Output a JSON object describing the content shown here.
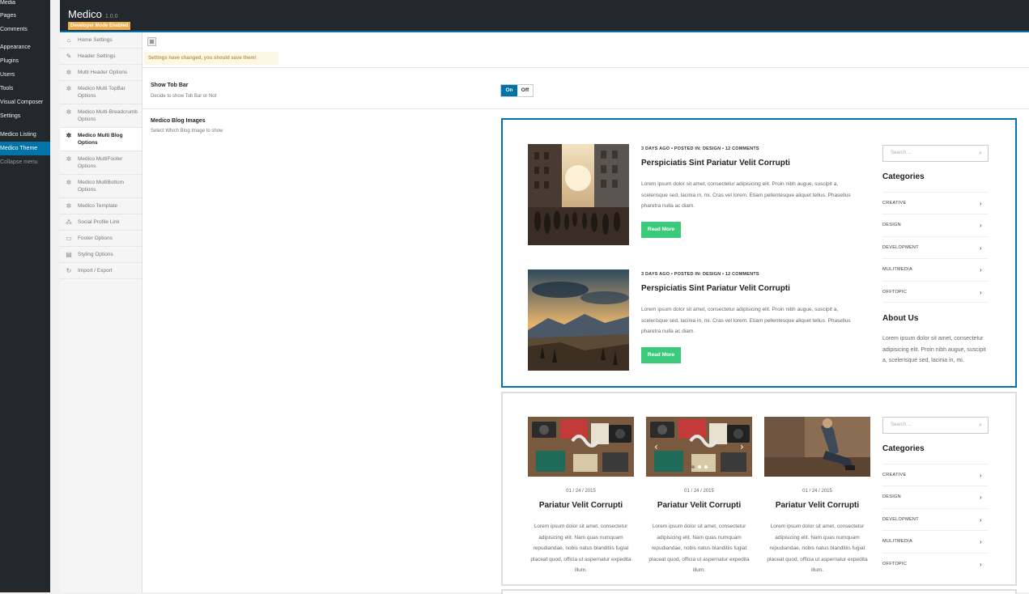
{
  "wp_menu": {
    "items": [
      "Media",
      "Pages",
      "Comments",
      "Appearance",
      "Plugins",
      "Users",
      "Tools",
      "Visual Composer",
      "Settings",
      "Medico Listing",
      "Medico Theme",
      "Collapse menu"
    ],
    "active": "Medico Theme"
  },
  "header": {
    "title": "Medico",
    "version": "1.0.0",
    "badge": "Developer Mode Enabled"
  },
  "sidenav": {
    "items": [
      {
        "label": "Home Settings",
        "icon": "home-icon"
      },
      {
        "label": "Header Settings",
        "icon": "pencil-icon"
      },
      {
        "label": "Multi Header Options",
        "icon": "cog-icon"
      },
      {
        "label": "Medico Multi TopBar Options",
        "icon": "cog-icon"
      },
      {
        "label": "Medico Multi-Breadcrumb Options",
        "icon": "cog-icon"
      },
      {
        "label": "Medico Multi Blog Options",
        "icon": "cog-icon"
      },
      {
        "label": "Medico MultiFooter Options",
        "icon": "cog-icon"
      },
      {
        "label": "Medico MultiBottom Options",
        "icon": "cog-icon"
      },
      {
        "label": "Medico Template",
        "icon": "cog-icon"
      },
      {
        "label": "Social Profile Link",
        "icon": "people-icon"
      },
      {
        "label": "Footer Options",
        "icon": "monitor-icon"
      },
      {
        "label": "Styling Options",
        "icon": "document-icon"
      },
      {
        "label": "Import / Export",
        "icon": "refresh-icon"
      }
    ],
    "active_index": 5
  },
  "notice": "Settings have changed, you should save them!",
  "fields": {
    "show_top_bar": {
      "title": "Show Tob Bar",
      "desc": "Decide to show Tob Bar or Not",
      "on_label": "On",
      "off_label": "Off",
      "value": "On"
    },
    "blog_images": {
      "title": "Medico Blog Images",
      "desc": "Select Which Blog Image to show"
    }
  },
  "layout1": {
    "posts": [
      {
        "meta": "3 DAYS AGO  •  POSTED IN: DESIGN  •  12 COMMENTS",
        "title": "Perspiciatis Sint Pariatur Velit Corrupti",
        "excerpt": "Lorem ipsum dolor sit amet, consectetur adipisicing elit. Proin nibh augue, suscipit a, scelerisque sed, lacinia in, mi. Cras vel lorem. Etiam pellentesque aliquet tellus. Phasellus pharetra nulla ac diam.",
        "button": "Read More"
      },
      {
        "meta": "3 DAYS AGO  •  POSTED IN: DESIGN  •  12 COMMENTS",
        "title": "Perspiciatis Sint Pariatur Velit Corrupti",
        "excerpt": "Lorem ipsum dolor sit amet, consectetur adipisicing elit. Proin nibh augue, suscipit a, scelerisque sed, lacinia in, mi. Cras vel lorem. Etiam pellentesque aliquet tellus. Phasellus pharetra nulla ac diam.",
        "button": "Read More"
      }
    ],
    "search_placeholder": "Search ...",
    "categories_title": "Categories",
    "categories": [
      "CREATIVE",
      "DESIGN",
      "DEVELOPMENT",
      "MULITMEDIA",
      "OFFTOPIC"
    ],
    "about_title": "About Us",
    "about_text": "Lorem ipsum dolor sit amet, consectetur adipisicing elit. Proin nibh augue, suscipit a, scelerisque sed, lacinia in, mi."
  },
  "layout2": {
    "posts": [
      {
        "date": "01 / 24 / 2015",
        "title": "Pariatur Velit Corrupti",
        "excerpt": "Lorem ipsum dolor sit amet, consectetur adipisicing elit. Nam quas numquam repudiandae, nobis natus blanditiis fugiat placeat quod, officia ut aspernatur expedita illum."
      },
      {
        "date": "01 / 24 / 2015",
        "title": "Pariatur Velit Corrupti",
        "excerpt": "Lorem ipsum dolor sit amet, consectetur adipisicing elit. Nam quas numquam repudiandae, nobis natus blanditiis fugiat placeat quod, officia ut aspernatur expedita illum."
      },
      {
        "date": "01 / 24 / 2015",
        "title": "Pariatur Velit Corrupti",
        "excerpt": "Lorem ipsum dolor sit amet, consectetur adipisicing elit. Nam quas numquam repudiandae, nobis natus blanditiis fugiat placeat quod, officia ut aspernatur expedita illum."
      }
    ],
    "search_placeholder": "Search ...",
    "categories_title": "Categories",
    "categories": [
      "CREATIVE",
      "DESIGN",
      "DEVELOPMENT",
      "MULITMEDIA",
      "OFFTOPIC"
    ]
  },
  "colors": {
    "admin_bg": "#23282d",
    "accent": "#0073aa",
    "read_more": "#3bc97b",
    "badge": "#f0ad4e",
    "notice_bg": "#fcf8e3"
  }
}
